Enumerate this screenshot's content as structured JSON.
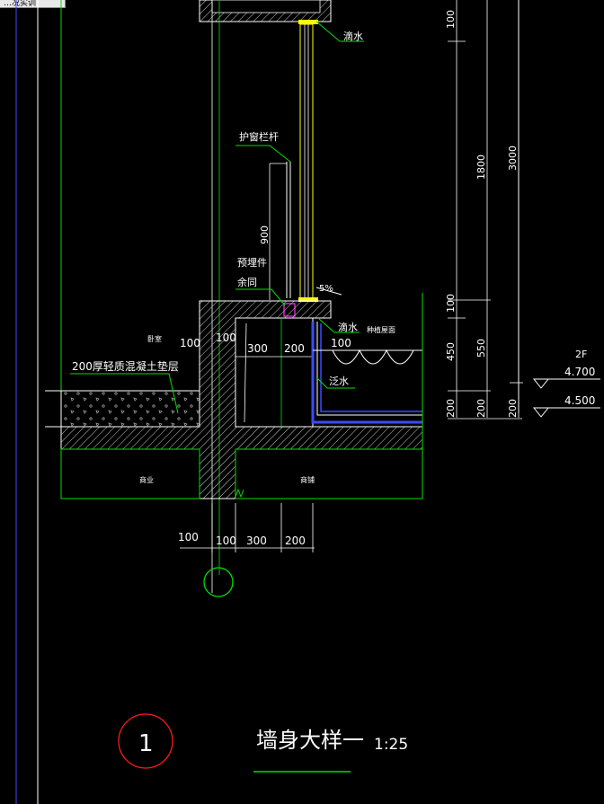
{
  "tab": {
    "label": "…况实训"
  },
  "labels": {
    "drip_top": "滴水",
    "railing": "护窗栏杆",
    "embedded": "预埋件",
    "embedded2": "余同",
    "slope": "5%",
    "drip_mid": "滴水",
    "planting": "种植屋面",
    "flashing": "泛水",
    "bedroom": "卧室",
    "cushion": "200厚轻质混凝土垫层",
    "room_left": "商业",
    "room_right": "商铺",
    "floor": "2F"
  },
  "dims": {
    "d100a": "100",
    "d100b": "100",
    "d300": "300",
    "d200": "200",
    "d100c": "100",
    "b100a": "100",
    "b100b": "100",
    "b300": "300",
    "b200": "200",
    "h900": "900",
    "v100a": "100",
    "v1800": "1800",
    "v3000": "3000",
    "v100b": "100",
    "v450": "450",
    "v550": "550",
    "v200a": "200",
    "v200b": "200",
    "v200c": "200",
    "e4700": "4.700",
    "e4500": "4.500"
  },
  "title": {
    "number": "1",
    "text": "墙身大样一",
    "scale": "1:25"
  },
  "colors": {
    "white": "#ffffff",
    "green": "#00e000",
    "yellow": "#ffff00",
    "red": "#ff1a1a",
    "blue": "#3a4cff",
    "magenta": "#ff33ff"
  }
}
